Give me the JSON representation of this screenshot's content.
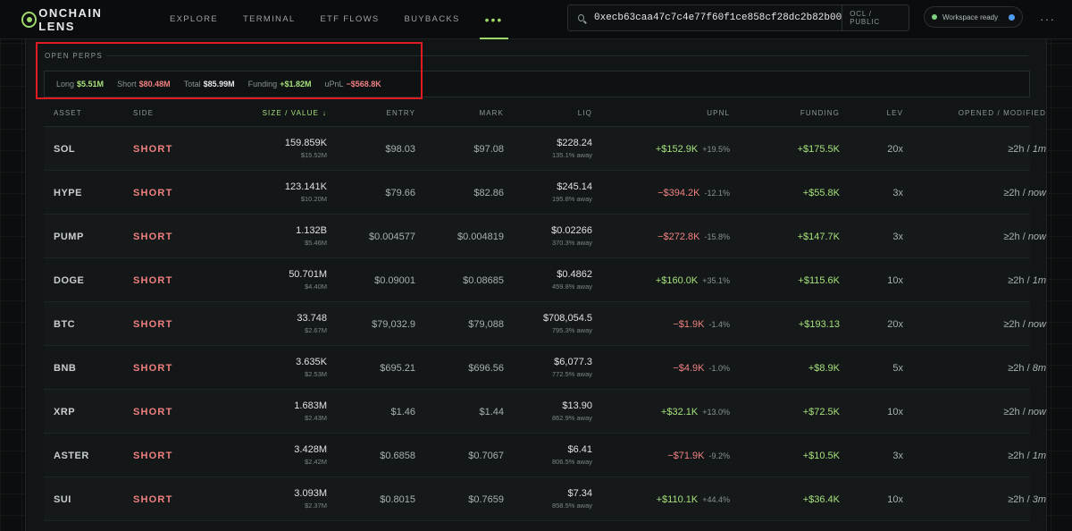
{
  "app": {
    "brand": "ONCHAIN LENS"
  },
  "nav": [
    {
      "label": "EXPLORE"
    },
    {
      "label": "TERMINAL"
    },
    {
      "label": "ETF FLOWS"
    },
    {
      "label": "BUYBACKS"
    },
    {
      "label": "•••"
    }
  ],
  "search": {
    "value": "0xecb63caa47c7c4e77f60f1ce858cf28dc2b82b00",
    "scope": "OCL / PUBLIC"
  },
  "workspace": {
    "status": "Workspace ready"
  },
  "section": {
    "title": "OPEN PERPS"
  },
  "summary": {
    "long_label": "Long",
    "long_value": "$5.51M",
    "short_label": "Short",
    "short_value": "$80.48M",
    "total_label": "Total",
    "total_value": "$85.99M",
    "funding_label": "Funding",
    "funding_value": "+$1.82M",
    "upnl_label": "uPnL",
    "upnl_value": "−$568.8K"
  },
  "table": {
    "headers": {
      "asset": "ASSET",
      "side": "SIDE",
      "size": "SIZE / VALUE",
      "size_arrow": "↓",
      "entry": "ENTRY",
      "mark": "MARK",
      "liq": "LIQ",
      "upnl": "UPNL",
      "funding": "FUNDING",
      "lev": "LEV",
      "opened": "OPENED / MODIFIED"
    },
    "rows": [
      {
        "asset": "SOL",
        "side": "SHORT",
        "size": "159.859K",
        "value": "$15.52M",
        "entry": "$98.03",
        "mark": "$97.08",
        "liq": "$228.24",
        "liq_away": "135.1% away",
        "upnl": "+$152.9K",
        "upnl_pct": "+19.5%",
        "upnl_color": "#a6e07a",
        "funding": "+$175.5K",
        "lev": "20x",
        "opened": "≥2h / ",
        "modified": "1m"
      },
      {
        "asset": "HYPE",
        "side": "SHORT",
        "size": "123.141K",
        "value": "$10.20M",
        "entry": "$79.66",
        "mark": "$82.86",
        "liq": "$245.14",
        "liq_away": "195.8% away",
        "upnl": "−$394.2K",
        "upnl_pct": "-12.1%",
        "upnl_color": "#f08080",
        "funding": "+$55.8K",
        "lev": "3x",
        "opened": "≥2h / ",
        "modified": "now"
      },
      {
        "asset": "PUMP",
        "side": "SHORT",
        "size": "1.132B",
        "value": "$5.46M",
        "entry": "$0.004577",
        "mark": "$0.004819",
        "liq": "$0.02266",
        "liq_away": "370.3% away",
        "upnl": "−$272.8K",
        "upnl_pct": "-15.8%",
        "upnl_color": "#f08080",
        "funding": "+$147.7K",
        "lev": "3x",
        "opened": "≥2h / ",
        "modified": "now"
      },
      {
        "asset": "DOGE",
        "side": "SHORT",
        "size": "50.701M",
        "value": "$4.40M",
        "entry": "$0.09001",
        "mark": "$0.08685",
        "liq": "$0.4862",
        "liq_away": "459.8% away",
        "upnl": "+$160.0K",
        "upnl_pct": "+35.1%",
        "upnl_color": "#a6e07a",
        "funding": "+$115.6K",
        "lev": "10x",
        "opened": "≥2h / ",
        "modified": "1m"
      },
      {
        "asset": "BTC",
        "side": "SHORT",
        "size": "33.748",
        "value": "$2.67M",
        "entry": "$79,032.9",
        "mark": "$79,088",
        "liq": "$708,054.5",
        "liq_away": "795.3% away",
        "upnl": "−$1.9K",
        "upnl_pct": "-1.4%",
        "upnl_color": "#f08080",
        "funding": "+$193.13",
        "lev": "20x",
        "opened": "≥2h / ",
        "modified": "now"
      },
      {
        "asset": "BNB",
        "side": "SHORT",
        "size": "3.635K",
        "value": "$2.53M",
        "entry": "$695.21",
        "mark": "$696.56",
        "liq": "$6,077.3",
        "liq_away": "772.5% away",
        "upnl": "−$4.9K",
        "upnl_pct": "-1.0%",
        "upnl_color": "#f08080",
        "funding": "+$8.9K",
        "lev": "5x",
        "opened": "≥2h / ",
        "modified": "8m"
      },
      {
        "asset": "XRP",
        "side": "SHORT",
        "size": "1.683M",
        "value": "$2.43M",
        "entry": "$1.46",
        "mark": "$1.44",
        "liq": "$13.90",
        "liq_away": "862.9% away",
        "upnl": "+$32.1K",
        "upnl_pct": "+13.0%",
        "upnl_color": "#a6e07a",
        "funding": "+$72.5K",
        "lev": "10x",
        "opened": "≥2h / ",
        "modified": "now"
      },
      {
        "asset": "ASTER",
        "side": "SHORT",
        "size": "3.428M",
        "value": "$2.42M",
        "entry": "$0.6858",
        "mark": "$0.7067",
        "liq": "$6.41",
        "liq_away": "806.5% away",
        "upnl": "−$71.9K",
        "upnl_pct": "-9.2%",
        "upnl_color": "#f08080",
        "funding": "+$10.5K",
        "lev": "3x",
        "opened": "≥2h / ",
        "modified": "1m"
      },
      {
        "asset": "SUI",
        "side": "SHORT",
        "size": "3.093M",
        "value": "$2.37M",
        "entry": "$0.8015",
        "mark": "$0.7659",
        "liq": "$7.34",
        "liq_away": "858.5% away",
        "upnl": "+$110.1K",
        "upnl_pct": "+44.4%",
        "upnl_color": "#a6e07a",
        "funding": "+$36.4K",
        "lev": "10x",
        "opened": "≥2h / ",
        "modified": "3m"
      }
    ]
  },
  "colors": {
    "accent": "#9fd86b",
    "positive": "#a6e07a",
    "negative": "#f08080",
    "annotation": "#e01b22"
  }
}
